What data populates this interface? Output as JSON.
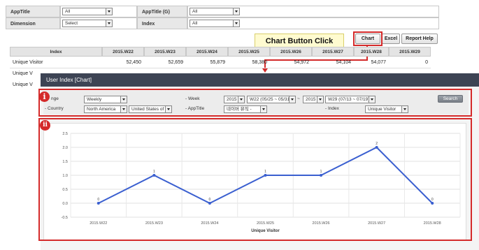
{
  "filters": {
    "apptitle_label": "AppTitle",
    "apptitle_value": "All",
    "apptitle_g_label": "AppTitle (G)",
    "apptitle_g_value": "All",
    "dimension_label": "Dimension",
    "dimension_value": "Select",
    "index_label": "Index",
    "index_value": "All"
  },
  "callout": "Chart Button Click",
  "buttons": {
    "chart": "Chart",
    "excel": "Excel",
    "report_help": "Report Help"
  },
  "grid": {
    "headers": [
      "Index",
      "2015.W22",
      "2015.W23",
      "2015.W24",
      "2015.W25",
      "2015.W26",
      "2015.W27",
      "2015.W28",
      "2015.W29"
    ],
    "row_label": "Unique Visitor",
    "row_values": [
      "52,450",
      "52,659",
      "55,879",
      "58,380",
      "54,972",
      "54,104",
      "54,077",
      "0"
    ],
    "partial_labels": [
      "Unique V",
      "Unique V"
    ]
  },
  "dialog": {
    "title": "User Index [Chart]",
    "badge1": "i",
    "badge2": "ii",
    "range_label": "nge",
    "range_value": "Weekly",
    "week_label": "- Week",
    "week_from_year": "2015",
    "week_from": "W22 (05/25 ~ 05/31)",
    "week_sep": "~",
    "week_to_year": "2015",
    "week_to": "W29 (07/13 ~ 07/19)",
    "search": "Search",
    "country_label": "- Country",
    "country_region": "North America",
    "country_value": "United States of",
    "apptitle_label": "- AppTitle",
    "apptitle_value": "네이버 뮤직 -",
    "index_label": "- Index",
    "index_value": "Unique Visitor"
  },
  "chart_data": {
    "type": "line",
    "categories": [
      "2015.W22",
      "2015.W23",
      "2015.W24",
      "2015.W25",
      "2015.W26",
      "2015.W27",
      "2015.W28"
    ],
    "series": [
      {
        "values": [
          0,
          1,
          0,
          1,
          1,
          2,
          0
        ]
      }
    ],
    "data_labels": [
      "0",
      "1",
      "0",
      "1",
      "1",
      "2",
      "0"
    ],
    "xlabel": "Unique Visitor",
    "ylabel": "",
    "ylim": [
      -0.5,
      2.5
    ],
    "yticks": [
      "2.5",
      "2.0",
      "1.5",
      "1.0",
      "0.5",
      "0.0",
      "-0.5"
    ],
    "grid": true,
    "line_color": "#3a5fd0"
  }
}
